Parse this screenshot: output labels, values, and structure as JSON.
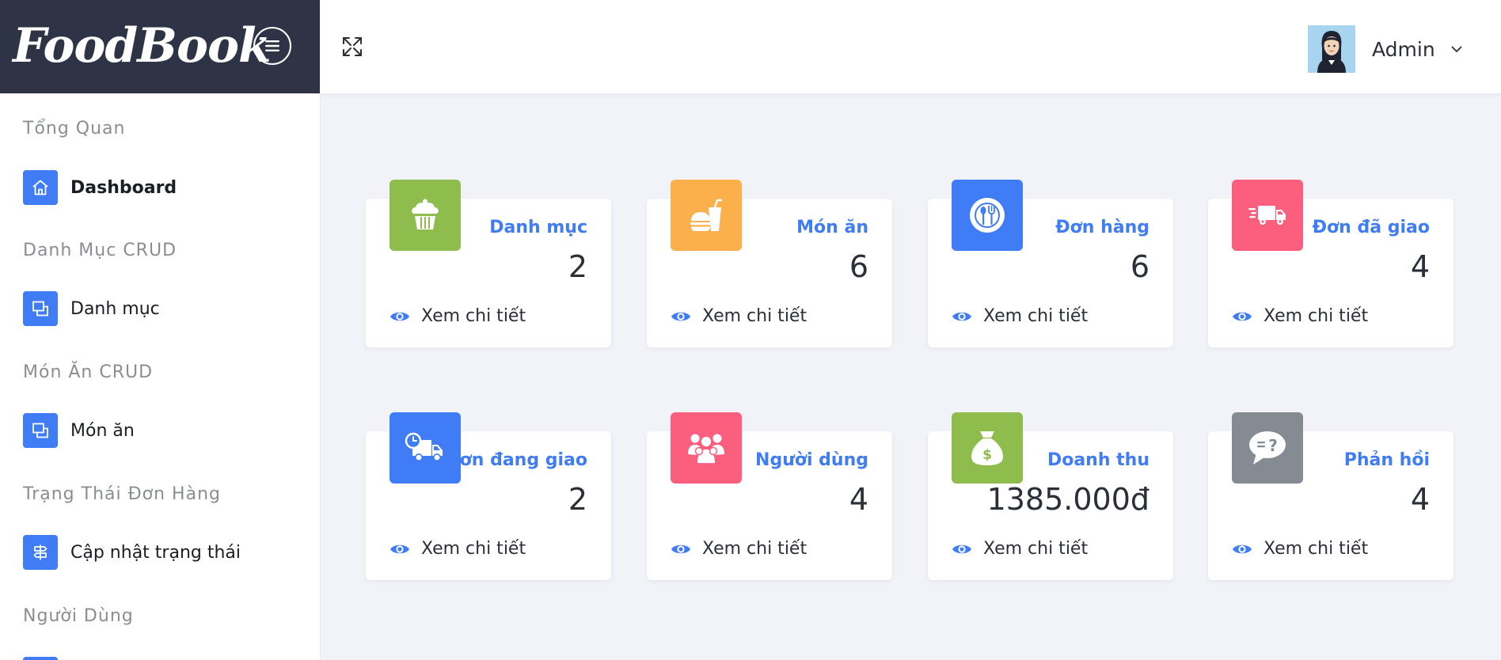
{
  "brand": {
    "logo_text": "FoodBook"
  },
  "sidebar": {
    "sections": [
      {
        "title": "Tổng Quan",
        "items": [
          {
            "label": "Dashboard",
            "icon": "home-icon"
          }
        ]
      },
      {
        "title": "Danh Mục CRUD",
        "items": [
          {
            "label": "Danh mục",
            "icon": "windows-icon"
          }
        ]
      },
      {
        "title": "Món Ăn CRUD",
        "items": [
          {
            "label": "Món ăn",
            "icon": "windows-icon"
          }
        ]
      },
      {
        "title": "Trạng Thái Đơn Hàng",
        "items": [
          {
            "label": "Cập nhật trạng thái",
            "icon": "signpost-icon"
          }
        ]
      },
      {
        "title": "Người Dùng",
        "items": []
      }
    ],
    "active_item": "Dashboard"
  },
  "header": {
    "user_name": "Admin"
  },
  "colors": {
    "accent": "#3f7cf6",
    "sidebar_header": "#2e3446",
    "green": "#8fbd4d",
    "orange": "#fcb04c",
    "blue": "#3f7cf6",
    "pink": "#fb5f7d",
    "gray": "#868b93",
    "background": "#f1f3f8"
  },
  "cards": [
    {
      "title": "Danh mục",
      "value": "2",
      "link": "Xem chi tiết",
      "icon": "cupcake-icon",
      "color": "#8fbd4d"
    },
    {
      "title": "Món ăn",
      "value": "6",
      "link": "Xem chi tiết",
      "icon": "burger-drink-icon",
      "color": "#fcb04c"
    },
    {
      "title": "Đơn hàng",
      "value": "6",
      "link": "Xem chi tiết",
      "icon": "plate-cutlery-icon",
      "color": "#3f7cf6"
    },
    {
      "title": "Đơn đã giao",
      "value": "4",
      "link": "Xem chi tiết",
      "icon": "delivery-truck-icon",
      "color": "#fb5f7d"
    },
    {
      "title": "Đơn đang giao",
      "value": "2",
      "link": "Xem chi tiết",
      "icon": "truck-clock-icon",
      "color": "#3f7cf6"
    },
    {
      "title": "Người dùng",
      "value": "4",
      "link": "Xem chi tiết",
      "icon": "users-group-icon",
      "color": "#fb5f7d"
    },
    {
      "title": "Doanh thu",
      "value": "1385.000đ",
      "link": "Xem chi tiết",
      "icon": "money-bag-icon",
      "color": "#8fbd4d"
    },
    {
      "title": "Phản hồi",
      "value": "4",
      "link": "Xem chi tiết",
      "icon": "feedback-bubble-icon",
      "color": "#868b93"
    }
  ]
}
